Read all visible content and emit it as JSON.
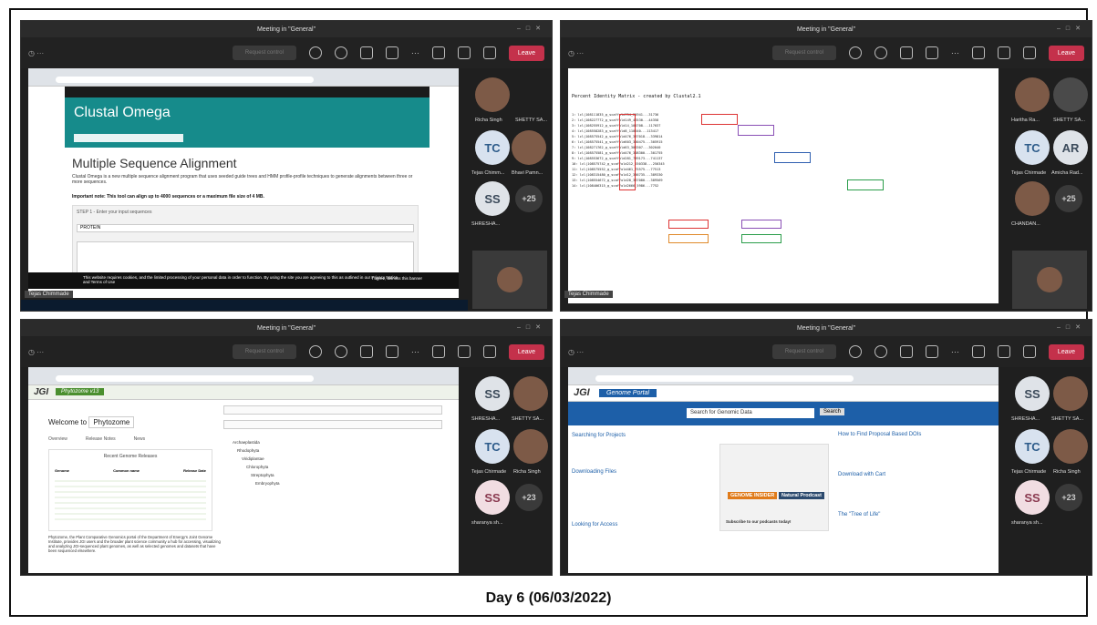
{
  "caption": "Day 6 (06/03/2022)",
  "meeting": {
    "title": "Meeting in \"General\"",
    "leave": "Leave",
    "request": "Request control"
  },
  "q1": {
    "site_title": "Clustal Omega",
    "heading": "Multiple Sequence Alignment",
    "intro": "Clustal Omega is a new multiple sequence alignment program that uses seeded guide trees and HMM profile-profile techniques to generate alignments between three or more sequences.",
    "note": "Important note: This tool can align up to 4000 sequences or a maximum file size of 4 MB.",
    "step": "STEP 1 - Enter your input sequences",
    "select": "PROTEIN",
    "cookie": "This website requires cookies, and the limited processing of your personal data in order to function. By using the site you are agreeing to this as outlined in our Privacy Notice and Terms of Use",
    "cookie_btn": "I agree, dismiss this banner",
    "presenter": "Tejas Chimmade",
    "participants": [
      {
        "initials": "",
        "name": "Richa Singh"
      },
      {
        "initials": "",
        "name": "SHETTY SA..."
      },
      {
        "initials": "TC",
        "name": "Tejas Chimm..."
      },
      {
        "initials": "",
        "name": "Bhavi Pamn..."
      },
      {
        "initials": "SS",
        "name": "SHRESHA..."
      },
      {
        "initials": "+25",
        "name": ""
      }
    ]
  },
  "q2": {
    "matrix_title": "Percent Identity  Matrix - created by Clustal2.1",
    "presenter": "Tejas Chimmade",
    "rows": [
      "1: lcl|108111835_g_scaffold754_25941...31736",
      "2: lcl|108227772_g_scaffold149_46530...44358",
      "3: lcl|108255912_g_scaffold14_104708...117037",
      "4: lcl|108558283_g_scaffold8_110540...113417",
      "5: lcl|108575542_g_scaffold476_337018...339814",
      "6: lcl|108575541_g_scaffold603_300475...305915",
      "7: lcl|108271762_g_scaffold63_308307...302040",
      "8: lcl|108575581_g_scaffold476_308300...301755",
      "9: lcl|108553672_g_scaffold281_739173...741137",
      "10: lcl|108575742_g_scaffold212_250338...250345",
      "11: lcl|108575552_g_scaffold461_75575...77513",
      "12: lcl|108315480_g_scaffold12_386735...389330",
      "13: lcl|108554672_g_scaffold20_387080...389569",
      "14: lcl|108406315_g_scaffold2666_5986...7752"
    ],
    "participants": [
      {
        "initials": "",
        "name": "Haritha Ra..."
      },
      {
        "initials": "",
        "name": "SHETTY SA..."
      },
      {
        "initials": "TC",
        "name": "Tejas Chirmade"
      },
      {
        "initials": "AR",
        "name": "Amicha Rad..."
      },
      {
        "initials": "",
        "name": "CHANDAN..."
      },
      {
        "initials": "+25",
        "name": ""
      }
    ]
  },
  "q3": {
    "site": "Phytozome v13",
    "welcome": "Welcome to",
    "welcome_sel": "Phytozome",
    "tabs": [
      "Overview",
      "Release Notes",
      "News"
    ],
    "table_title": "Recent Genome Releases",
    "cols": [
      "Genome",
      "Common name",
      "Release Date"
    ],
    "body": "Phytozome, the Plant Comparative Genomics portal of the Department of Energy's Joint Genome Institute, provides JGI users and the broader plant science community a hub for accessing, visualizing and analyzing JGI-sequenced plant genomes, as well as selected genomes and datasets that have been sequenced elsewhere.",
    "tree": [
      "Archaeplastida",
      "Rhodophyta",
      "Viridiplantae",
      "Chlorophyta",
      "Streptophyta",
      "Embryophyta"
    ],
    "participants": [
      {
        "initials": "SS",
        "name": "SHRESHA..."
      },
      {
        "initials": "",
        "name": "SHETTY SA..."
      },
      {
        "initials": "TC",
        "name": "Tejas Chirmade"
      },
      {
        "initials": "",
        "name": "Richa Singh"
      },
      {
        "initials": "SS",
        "name": "sharanya sh..."
      },
      {
        "initials": "+23",
        "name": ""
      }
    ]
  },
  "q4": {
    "portal": "Genome Portal",
    "search": "Search for Genomic Data",
    "search_btn": "Search",
    "sec1": "Searching for Projects",
    "sec2": "Downloading Files",
    "sec3": "Looking for Access",
    "right1": "How to Find Proposal Based DOIs",
    "right2": "Download with Cart",
    "right3": "The \"Tree of Life\"",
    "podcast1": "GENOME INSIDER",
    "podcast2": "Natural Prodcast",
    "podcast_sub": "Subscribe to our podcasts today!",
    "participants": [
      {
        "initials": "SS",
        "name": "SHRESHA..."
      },
      {
        "initials": "",
        "name": "SHETTY SA..."
      },
      {
        "initials": "TC",
        "name": "Tejas Chirmade"
      },
      {
        "initials": "",
        "name": "Richa Singh"
      },
      {
        "initials": "SS",
        "name": "sharanya sh..."
      },
      {
        "initials": "+23",
        "name": ""
      }
    ]
  }
}
